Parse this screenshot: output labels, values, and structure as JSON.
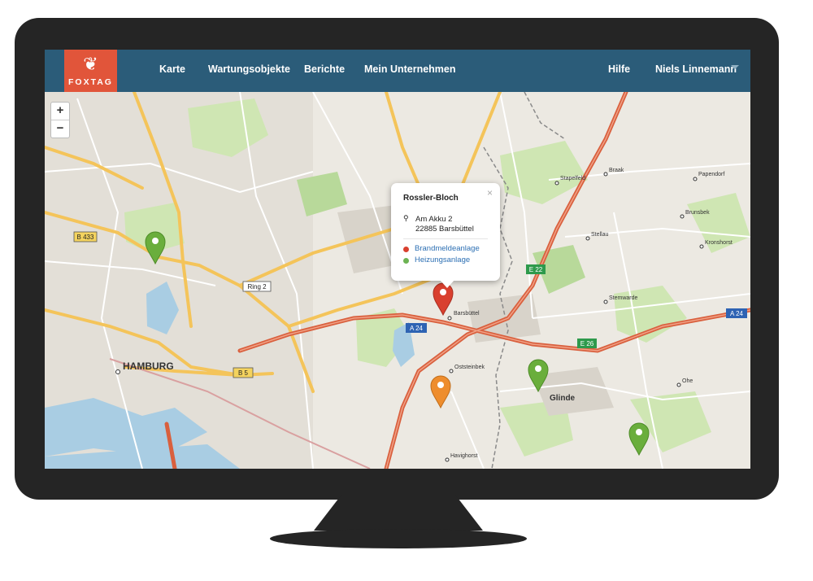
{
  "nav": {
    "logo_mark": "❦",
    "logo_text": "FOXTAG",
    "items": [
      "Karte",
      "Wartungsobjekte",
      "Berichte",
      "Mein Unternehmen"
    ],
    "help": "Hilfe",
    "user": "Niels Linnemann"
  },
  "map": {
    "zoom_in": "+",
    "zoom_out": "−",
    "places": {
      "hamburg": "HAMBURG",
      "glinde": "Glinde",
      "barsbuettel": "Barsbüttel",
      "stapelfeld": "Stapelfeld",
      "braak": "Braak",
      "papendorf": "Papendorf",
      "brunsbek": "Brunsbek",
      "stellau": "Stellau",
      "kronshorst": "Kronshorst",
      "stemwarde": "Stemwarde",
      "oststeinbek": "Oststeinbek",
      "ohe": "Ohe",
      "havighorst": "Havighorst"
    },
    "roads": {
      "b433": "B 433",
      "ring2": "Ring 2",
      "b5": "B 5",
      "a24_center": "A 24",
      "a24_right": "A 24",
      "e22": "E 22",
      "e26": "E 26"
    }
  },
  "popup": {
    "title": "Rossler-Bloch",
    "close": "×",
    "address_icon": "⚲",
    "address_line1": "Am Akku 2",
    "address_line2": "22885 Barsbüttel",
    "links": [
      {
        "label": "Brandmeldeanlage",
        "color": "#d9402f"
      },
      {
        "label": "Heizungsanlage",
        "color": "#6cb353"
      }
    ]
  },
  "colors": {
    "nav_bg": "#2b5c79",
    "logo_bg": "#e1553a",
    "marker_red": "#d9402f",
    "marker_green": "#6aae3c",
    "marker_orange": "#ee8d2d",
    "motorway": "#d9603e",
    "primary_road": "#f4c45a"
  }
}
